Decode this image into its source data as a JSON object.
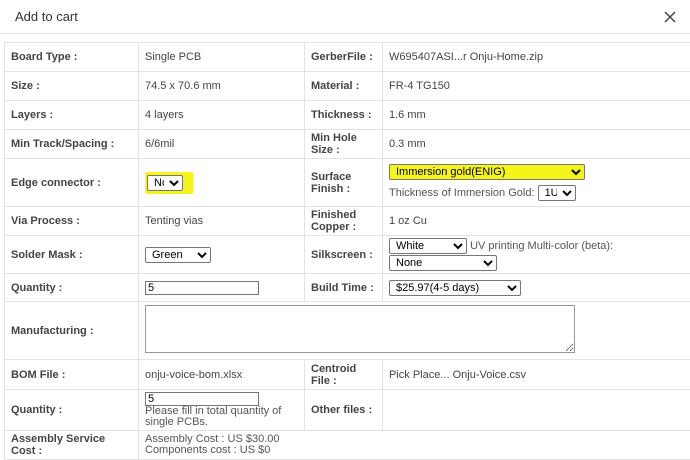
{
  "dialog": {
    "title": "Add to cart"
  },
  "rows": {
    "board_type": {
      "label": "Board Type :",
      "value": "Single PCB"
    },
    "gerber": {
      "label": "GerberFile :",
      "value": "W695407ASI...r Onju-Home.zip"
    },
    "size": {
      "label": "Size :",
      "value": "74.5 x 70.6 mm"
    },
    "material": {
      "label": "Material :",
      "value": "FR-4 TG150"
    },
    "layers": {
      "label": "Layers :",
      "value": "4 layers"
    },
    "thickness": {
      "label": "Thickness :",
      "value": "1.6 mm"
    },
    "min_track": {
      "label": "Min Track/Spacing :",
      "value": "6/6mil"
    },
    "min_hole": {
      "label": "Min Hole Size :",
      "value": "0.3 mm"
    },
    "edge_connector": {
      "label": "Edge connector :",
      "value": "No"
    },
    "surface_finish": {
      "label": "Surface Finish :",
      "value": "Immersion gold(ENIG)",
      "gold_thickness_label": "Thickness of Immersion Gold:",
      "gold_thickness_value": "1U\""
    },
    "via_process": {
      "label": "Via Process :",
      "value": "Tenting vias"
    },
    "finished_copper": {
      "label": "Finished Copper :",
      "value": "1 oz Cu"
    },
    "solder_mask": {
      "label": "Solder Mask :",
      "value": "Green"
    },
    "silkscreen": {
      "label": "Silkscreen :",
      "value": "White",
      "uv_label": "UV printing Multi-color (beta):",
      "uv_value": "None"
    },
    "quantity": {
      "label": "Quantity :",
      "value": "5"
    },
    "build_time": {
      "label": "Build Time :",
      "value": "$25.97(4-5 days)"
    },
    "manufacturing": {
      "label": "Manufacturing :",
      "value": ""
    },
    "bom": {
      "label": "BOM File :",
      "value": "onju-voice-bom.xlsx"
    },
    "centroid": {
      "label": "Centroid File :",
      "value": "Pick Place... Onju-Voice.csv"
    },
    "assembly_quantity": {
      "label": "Quantity :",
      "value": "5",
      "note": "Please fill in total quantity of single PCBs."
    },
    "other_files": {
      "label": "Other files :"
    },
    "assembly_cost": {
      "label": "Assembly Service Cost :",
      "assembly": "Assembly Cost : US $30.00",
      "components": "Components cost : US $0"
    }
  },
  "colors": {
    "highlight": "#f5f51a",
    "border": "#e3e3e3"
  }
}
